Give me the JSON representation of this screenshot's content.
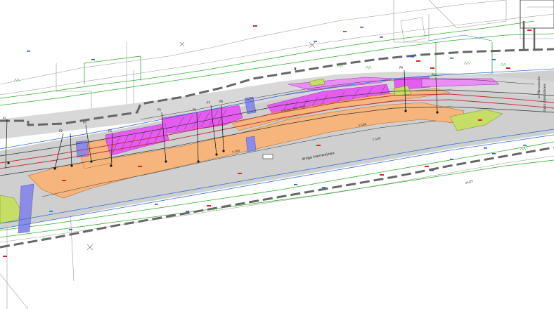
{
  "colors": {
    "background": "#ffffff",
    "road_surface": "#cfcfcf",
    "platform_orange": "#f5b57d",
    "parking_magenta": "#e55df0",
    "green_area": "#c6dd66",
    "blue_crossing": "#8c8ce6",
    "boundary_dark": "#666666",
    "boundary_green": "#2fae2f",
    "curb_blue": "#2c6fd8",
    "track_red": "#c0303a",
    "track_dark": "#333333",
    "annotation_red": "#dd2222"
  },
  "labels": {
    "right_vertical_1": "ul. Warszawska",
    "right_vertical_2": "stacja przesiadkowa",
    "street_label_1": "droga tramwajowa",
    "street_label_2": "ścieżka rowerowa",
    "level_marks": [
      "1:100",
      "1:100",
      "1:100"
    ],
    "pier_labels": [
      "P1",
      "P2",
      "P3",
      "P4",
      "P5",
      "P6",
      "P7",
      "P8",
      "P9",
      "P10"
    ],
    "right_label": "24/25"
  },
  "icons": {
    "grass_tuft": "grass-tuft-icon",
    "tree_cross": "x-marker-icon",
    "point_dot": "survey-point-icon"
  }
}
